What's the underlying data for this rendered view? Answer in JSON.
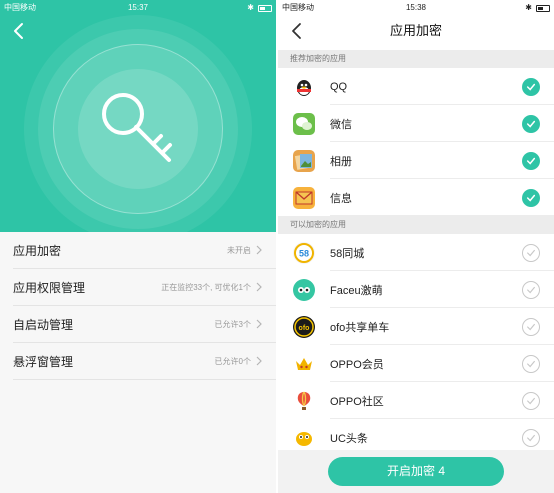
{
  "left": {
    "status": {
      "carrier": "中国移动",
      "time": "15:37"
    },
    "menu": [
      {
        "label": "应用加密",
        "value": "未开启"
      },
      {
        "label": "应用权限管理",
        "value": "正在监控33个, 可优化1个"
      },
      {
        "label": "自启动管理",
        "value": "已允许3个"
      },
      {
        "label": "悬浮窗管理",
        "value": "已允许0个"
      }
    ]
  },
  "right": {
    "status": {
      "carrier": "中国移动",
      "time": "15:38"
    },
    "title": "应用加密",
    "recommended_header": "推荐加密的应用",
    "recommended": [
      {
        "name": "QQ",
        "icon": "qq-icon",
        "checked": true
      },
      {
        "name": "微信",
        "icon": "wechat-icon",
        "checked": true
      },
      {
        "name": "相册",
        "icon": "gallery-icon",
        "checked": true
      },
      {
        "name": "信息",
        "icon": "messages-icon",
        "checked": true
      }
    ],
    "others_header": "可以加密的应用",
    "others": [
      {
        "name": "58同城",
        "icon": "58-icon",
        "icon_text": "58",
        "checked": false
      },
      {
        "name": "Faceu激萌",
        "icon": "faceu-icon",
        "icon_text": "",
        "checked": false
      },
      {
        "name": "ofo共享单车",
        "icon": "ofo-icon",
        "icon_text": "ofo",
        "checked": false
      },
      {
        "name": "OPPO会员",
        "icon": "oppo-member-icon",
        "icon_text": "",
        "checked": false
      },
      {
        "name": "OPPO社区",
        "icon": "oppo-community-icon",
        "icon_text": "",
        "checked": false
      },
      {
        "name": "UC头条",
        "icon": "uc-icon",
        "icon_text": "",
        "checked": false
      }
    ],
    "button_label": "开启加密 4"
  },
  "colors": {
    "accent": "#2ec4a6",
    "divider": "#ececec"
  }
}
